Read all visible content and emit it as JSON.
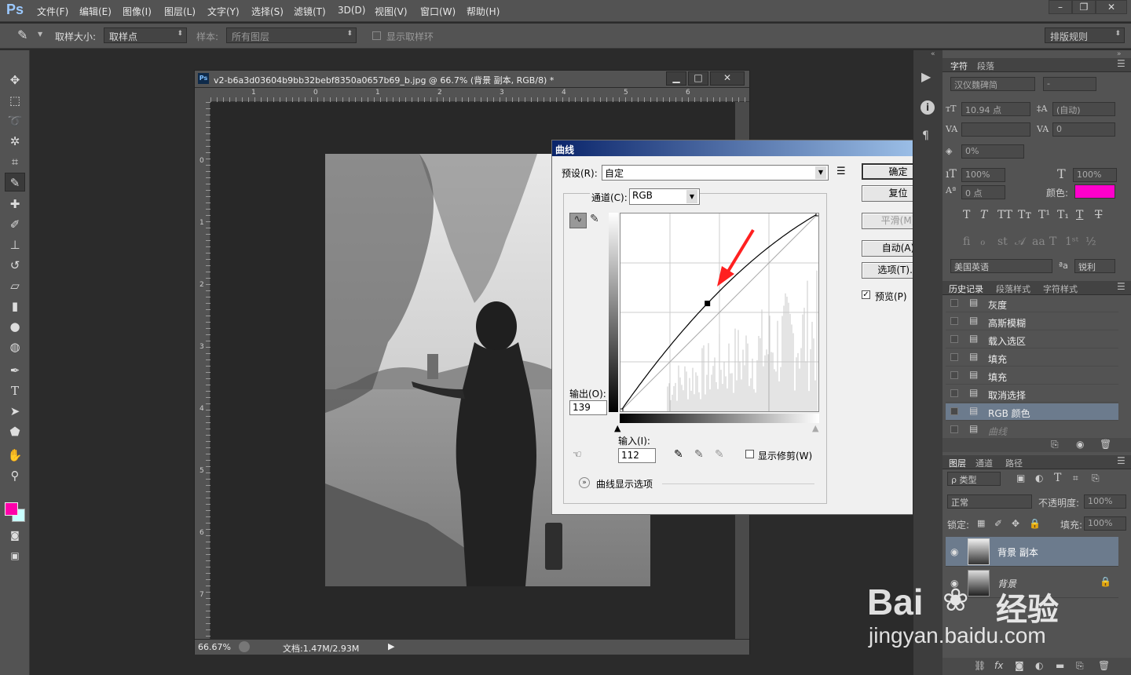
{
  "app": {
    "logo": "Ps"
  },
  "menu": [
    "文件(F)",
    "编辑(E)",
    "图像(I)",
    "图层(L)",
    "文字(Y)",
    "选择(S)",
    "滤镜(T)",
    "3D(D)",
    "视图(V)",
    "窗口(W)",
    "帮助(H)"
  ],
  "options": {
    "sample_size_label": "取样大小:",
    "sample_size_value": "取样点",
    "sample_label": "样本:",
    "sample_value": "所有图层",
    "show_ring": "显示取样环",
    "workspace": "排版规则"
  },
  "document": {
    "title": "v2-b6a3d03604b9bb32bebf8350a0657b69_b.jpg @ 66.7% (背景 副本, RGB/8) *",
    "zoom": "66.67%",
    "doc_size": "文档:1.47M/2.93M",
    "ruler_h": [
      "1",
      "0",
      "1",
      "2",
      "3",
      "4",
      "5",
      "6"
    ],
    "ruler_v": [
      "0",
      "1",
      "2",
      "3",
      "4",
      "5",
      "6",
      "7"
    ]
  },
  "curves": {
    "title": "曲线",
    "preset_label": "预设(R):",
    "preset_value": "自定",
    "channel_label": "通道(C):",
    "channel_value": "RGB",
    "output_label": "输出(O):",
    "output_value": "139",
    "input_label": "输入(I):",
    "input_value": "112",
    "show_clipping": "显示修剪(W)",
    "display_options": "曲线显示选项",
    "buttons": {
      "ok": "确定",
      "reset": "复位",
      "smooth": "平滑(M)",
      "auto": "自动(A)",
      "options": "选项(T)..."
    },
    "preview": "预览(P)",
    "curve_points": [
      [
        0,
        0
      ],
      [
        112,
        139
      ],
      [
        255,
        255
      ]
    ]
  },
  "character": {
    "tabs": [
      "字符",
      "段落"
    ],
    "font_family": "汉仪魏碑简",
    "font_style": "-",
    "size": "10.94 点",
    "leading": "(自动)",
    "kerning": "",
    "tracking": "0",
    "scale_pct": "0%",
    "vscale": "100%",
    "hscale": "100%",
    "baseline": "0 点",
    "color_label": "颜色:",
    "color": "#ff00cc",
    "language": "美国英语",
    "aa_icon": "ªa",
    "aa": "锐利"
  },
  "history": {
    "tabs": [
      "历史记录",
      "段落样式",
      "字符样式"
    ],
    "items": [
      "灰度",
      "高斯模糊",
      "载入选区",
      "填充",
      "填充",
      "取消选择",
      "RGB 颜色",
      "曲线"
    ]
  },
  "layers": {
    "tabs": [
      "图层",
      "通道",
      "路径"
    ],
    "kind": "ρ 类型",
    "blend": "正常",
    "opacity_label": "不透明度:",
    "opacity": "100%",
    "lock_label": "锁定:",
    "fill_label": "填充:",
    "fill": "100%",
    "items": [
      "背景 副本",
      "背景"
    ]
  },
  "watermark": {
    "brand": "Bai",
    "brand2": "经验",
    "url": "jingyan.baidu.com"
  },
  "colors": {
    "foreground": "#ff00aa",
    "background": "#c8ffff"
  }
}
